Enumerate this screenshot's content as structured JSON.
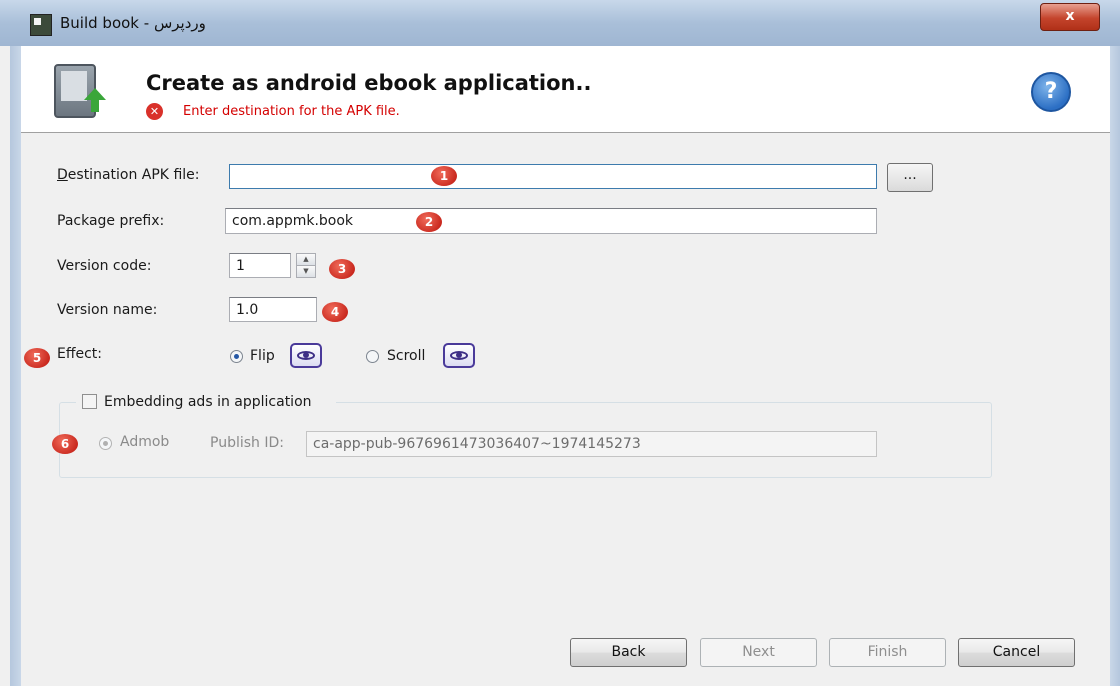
{
  "window": {
    "title": "Build book - وردپرس",
    "close_label": "x"
  },
  "header": {
    "heading": "Create as android ebook application..",
    "error": "Enter destination for the APK file.",
    "help_label": "?"
  },
  "form": {
    "destination": {
      "label": "Destination APK file:",
      "value": "",
      "browse_label": "..."
    },
    "package": {
      "label": "Package prefix:",
      "value": "com.appmk.book"
    },
    "version_code": {
      "label": "Version code:",
      "value": "1",
      "up": "▲",
      "down": "▼"
    },
    "version_name": {
      "label": "Version name:",
      "value": "1.0"
    },
    "effect": {
      "label": "Effect:",
      "options": [
        {
          "label": "Flip",
          "selected": true
        },
        {
          "label": "Scroll",
          "selected": false
        }
      ]
    },
    "ads": {
      "checkbox_label": "Embedding ads in application",
      "checked": false,
      "provider_label": "Admob",
      "publish_id_label": "Publish ID:",
      "publish_id_value": "ca-app-pub-9676961473036407~1974145273"
    }
  },
  "badges": [
    "1",
    "2",
    "3",
    "4",
    "5",
    "6"
  ],
  "buttons": {
    "back": "Back",
    "next": "Next",
    "finish": "Finish",
    "cancel": "Cancel"
  },
  "colors": {
    "error_text": "#d40000",
    "badge": "#c9281e",
    "help": "#2c6fc4"
  }
}
